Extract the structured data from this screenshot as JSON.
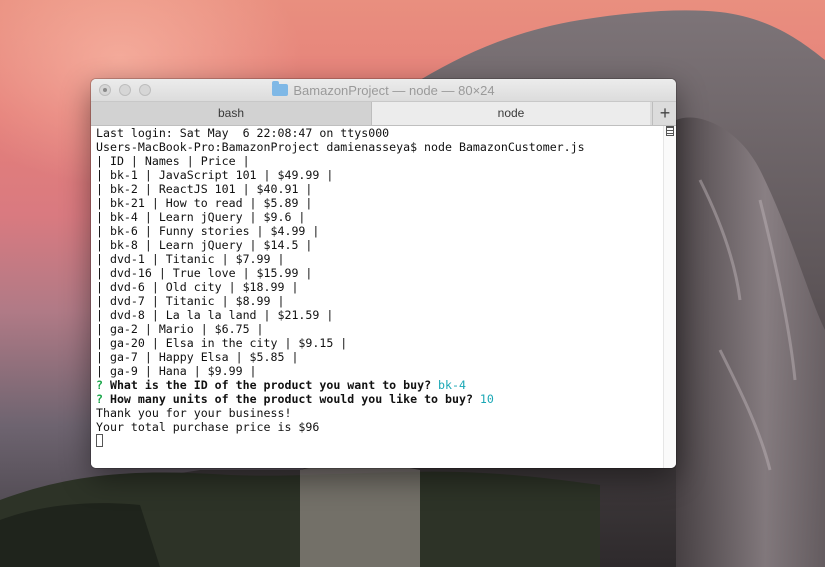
{
  "window": {
    "title": "BamazonProject — node — 80×24",
    "tabs": [
      {
        "label": "bash"
      },
      {
        "label": "node"
      }
    ],
    "new_tab_symbol": "+"
  },
  "terminal": {
    "lines": [
      "Last login: Sat May  6 22:08:47 on ttys000",
      "Users-MacBook-Pro:BamazonProject damienasseya$ node BamazonCustomer.js",
      "| ID | Names | Price |",
      "| bk-1 | JavaScript 101 | $49.99 |",
      "| bk-2 | ReactJS 101 | $40.91 |",
      "| bk-21 | How to read | $5.89 |",
      "| bk-4 | Learn jQuery | $9.6 |",
      "| bk-6 | Funny stories | $4.99 |",
      "| bk-8 | Learn jQuery | $14.5 |",
      "| dvd-1 | Titanic | $7.99 |",
      "| dvd-16 | True love | $15.99 |",
      "| dvd-6 | Old city | $18.99 |",
      "| dvd-7 | Titanic | $8.99 |",
      "| dvd-8 | La la la land | $21.59 |",
      "| ga-2 | Mario | $6.75 |",
      "| ga-20 | Elsa in the city | $9.15 |",
      "| ga-7 | Happy Elsa | $5.85 |",
      "| ga-9 | Hana | $9.99 |"
    ],
    "prompt1": {
      "mark": "?",
      "question": "What is the ID of the product you want to buy?",
      "answer": "bk-4"
    },
    "prompt2": {
      "mark": "?",
      "question": "How many units of the product would you like to buy?",
      "answer": "10"
    },
    "thanks": "Thank you for your business!",
    "total": "Your total purchase price is $96"
  },
  "colors": {
    "prompt_mark": "#1aa64a",
    "answer": "#1aa7b5"
  },
  "icons": {
    "folder": "folder-icon",
    "scroll": "scroll-marker-icon"
  }
}
